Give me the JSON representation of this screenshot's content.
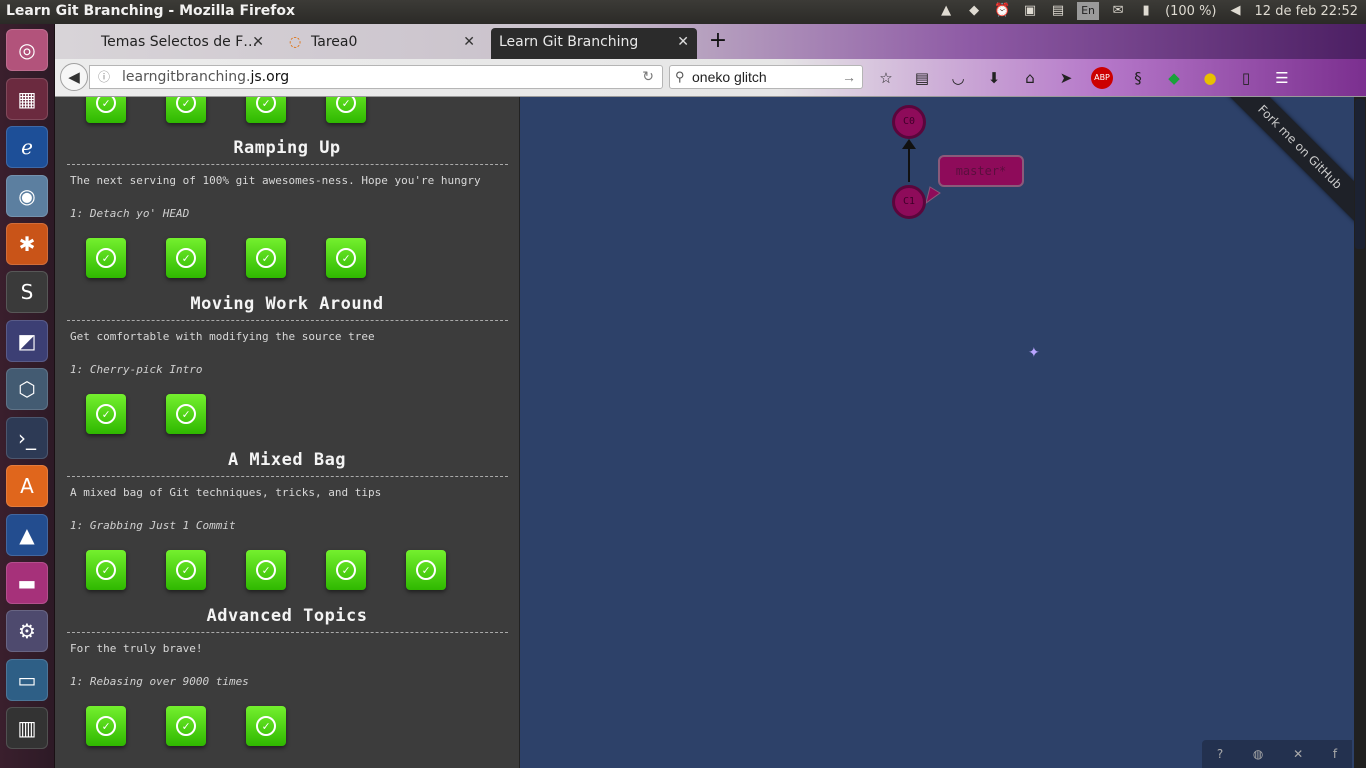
{
  "topbar": {
    "window_title": "Learn Git Branching - Mozilla Firefox",
    "keyboard_layout": "En",
    "battery": "(100 %)",
    "datetime": "12 de feb 22:52"
  },
  "tabs": [
    {
      "label": "Temas Selectos de F…"
    },
    {
      "label": "Tarea0"
    },
    {
      "label": "Learn Git Branching"
    }
  ],
  "navbar": {
    "url_prefix": "learngitbranching.",
    "url_domain": "js.org",
    "search_value": "oneko glitch"
  },
  "sequences": [
    {
      "title": "Ramping Up",
      "desc": "The next serving of 100% git awesomes-ness. Hope you're hungry",
      "level": "1: Detach yo' HEAD",
      "count": 4
    },
    {
      "title": "Moving Work Around",
      "desc": "Get comfortable with modifying the source tree",
      "level": "1: Cherry-pick Intro",
      "count": 2
    },
    {
      "title": "A Mixed Bag",
      "desc": "A mixed bag of Git techniques, tricks, and tips",
      "level": "1: Grabbing Just 1 Commit",
      "count": 5
    },
    {
      "title": "Advanced Topics",
      "desc": "For the truly brave!",
      "level": "1: Rebasing over 9000 times",
      "count": 3
    }
  ],
  "visualization": {
    "commit_c0": "C0",
    "commit_c1": "C1",
    "branch_label": "master*",
    "ribbon": "Fork me on GitHub"
  }
}
